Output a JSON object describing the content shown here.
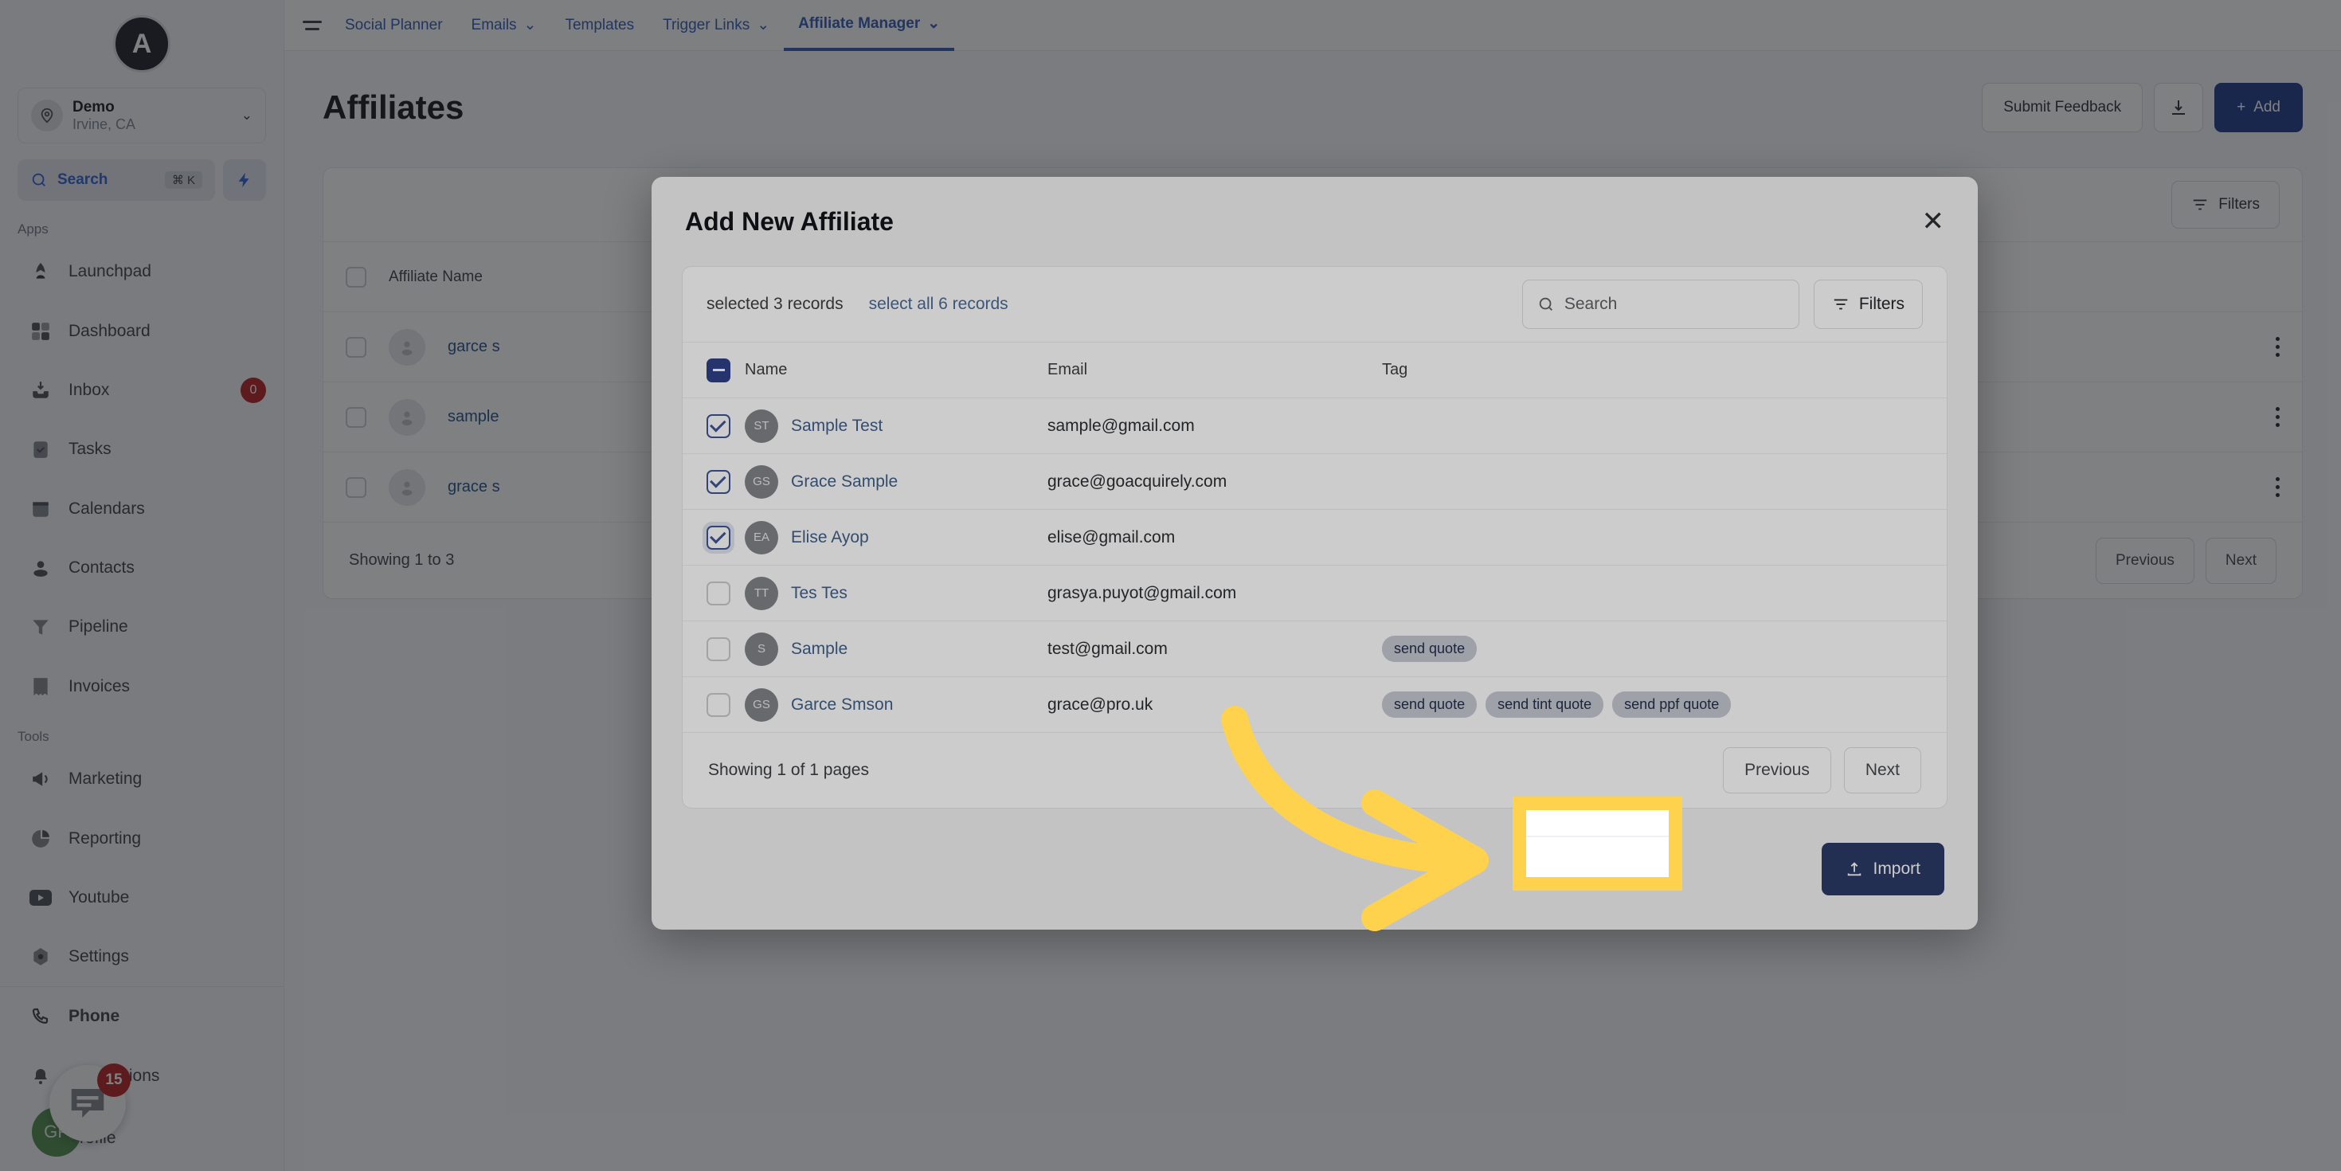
{
  "sidebar": {
    "logo_glyph": "A",
    "location": {
      "name": "Demo",
      "sub": "Irvine, CA"
    },
    "search": {
      "label": "Search",
      "shortcut": "⌘ K"
    },
    "groups": [
      {
        "label": "Apps",
        "items": [
          {
            "label": "Launchpad",
            "icon": "rocket-icon",
            "badge": ""
          },
          {
            "label": "Dashboard",
            "icon": "grid-icon",
            "badge": ""
          },
          {
            "label": "Inbox",
            "icon": "inbox-icon",
            "badge": "0"
          },
          {
            "label": "Tasks",
            "icon": "clipboard-check-icon",
            "badge": ""
          },
          {
            "label": "Calendars",
            "icon": "calendar-icon",
            "badge": ""
          },
          {
            "label": "Contacts",
            "icon": "person-icon",
            "badge": ""
          },
          {
            "label": "Pipeline",
            "icon": "funnel-icon",
            "badge": ""
          },
          {
            "label": "Invoices",
            "icon": "receipt-icon",
            "badge": ""
          }
        ]
      },
      {
        "label": "Tools",
        "items": [
          {
            "label": "Marketing",
            "icon": "megaphone-icon",
            "badge": ""
          },
          {
            "label": "Reporting",
            "icon": "pie-chart-icon",
            "badge": ""
          },
          {
            "label": "Youtube",
            "icon": "youtube-icon",
            "badge": ""
          },
          {
            "label": "Settings",
            "icon": "gear-icon",
            "badge": ""
          }
        ]
      }
    ],
    "footer_items": [
      {
        "label": "Phone",
        "icon": "phone-icon",
        "badge": ""
      },
      {
        "label": "Notifications",
        "icon": "bell-icon",
        "badge": ""
      },
      {
        "label": "Profile",
        "icon": "avatar-icon",
        "badge": ""
      }
    ],
    "chat_badge": "15",
    "avatar_initials": "GP"
  },
  "topbar": {
    "tabs": [
      {
        "label": "Social Planner",
        "caret": false,
        "active": false
      },
      {
        "label": "Emails",
        "caret": true,
        "active": false
      },
      {
        "label": "Templates",
        "caret": false,
        "active": false
      },
      {
        "label": "Trigger Links",
        "caret": true,
        "active": false
      },
      {
        "label": "Affiliate Manager",
        "caret": true,
        "active": true
      }
    ]
  },
  "page": {
    "title": "Affiliates",
    "submit_feedback_label": "Submit Feedback",
    "download_icon": "download-icon",
    "add_label": "Add",
    "filters_label": "Filters",
    "table_header": "Affiliate Name",
    "rows": [
      {
        "name": "garce s"
      },
      {
        "name": "sample"
      },
      {
        "name": "grace s"
      }
    ],
    "showing": "Showing 1 to 3",
    "prev_label": "Previous",
    "next_label": "Next"
  },
  "modal": {
    "title": "Add New Affiliate",
    "close_icon": "close-icon",
    "selected_text": "selected 3 records",
    "select_all_link": "select all 6 records",
    "search_placeholder": "Search",
    "filters_label": "Filters",
    "columns": [
      "Name",
      "Email",
      "Tag"
    ],
    "header_checkbox_state": "indeterminate",
    "rows": [
      {
        "checked": true,
        "ring": false,
        "initials": "ST",
        "name": "Sample Test",
        "email": "sample@gmail.com",
        "tags": []
      },
      {
        "checked": true,
        "ring": false,
        "initials": "GS",
        "name": "Grace Sample",
        "email": "grace@goacquirely.com",
        "tags": []
      },
      {
        "checked": true,
        "ring": true,
        "initials": "EA",
        "name": "Elise Ayop",
        "email": "elise@gmail.com",
        "tags": []
      },
      {
        "checked": false,
        "ring": false,
        "initials": "TT",
        "name": "Tes Tes",
        "email": "grasya.puyot@gmail.com",
        "tags": []
      },
      {
        "checked": false,
        "ring": false,
        "initials": "S",
        "name": "Sample",
        "email": "test@gmail.com",
        "tags": [
          "send quote"
        ]
      },
      {
        "checked": false,
        "ring": false,
        "initials": "GS",
        "name": "Garce Smson",
        "email": "grace@pro.uk",
        "tags": [
          "send quote",
          "send tint quote",
          "send ppf quote"
        ]
      }
    ],
    "showing": "Showing 1 of 1 pages",
    "prev_label": "Previous",
    "next_label": "Next",
    "import_label": "Import",
    "import_icon": "upload-icon"
  },
  "annotation": {
    "highlight_color": "#ffd24d",
    "arrow_color": "#ffd24d",
    "arrow_name": "curved-arrow-annotation",
    "highlight_name": "highlight-box-annotation"
  },
  "colors": {
    "accent_blue": "#2d56c9",
    "primary_button": "#1e3a8a",
    "link_blue": "#2a64ae",
    "badge_red": "#b32020",
    "tag_pill_bg": "#c2c9d8",
    "highlight_yellow": "#ffd24d",
    "sidebar_bg": "#f2f4f7"
  }
}
